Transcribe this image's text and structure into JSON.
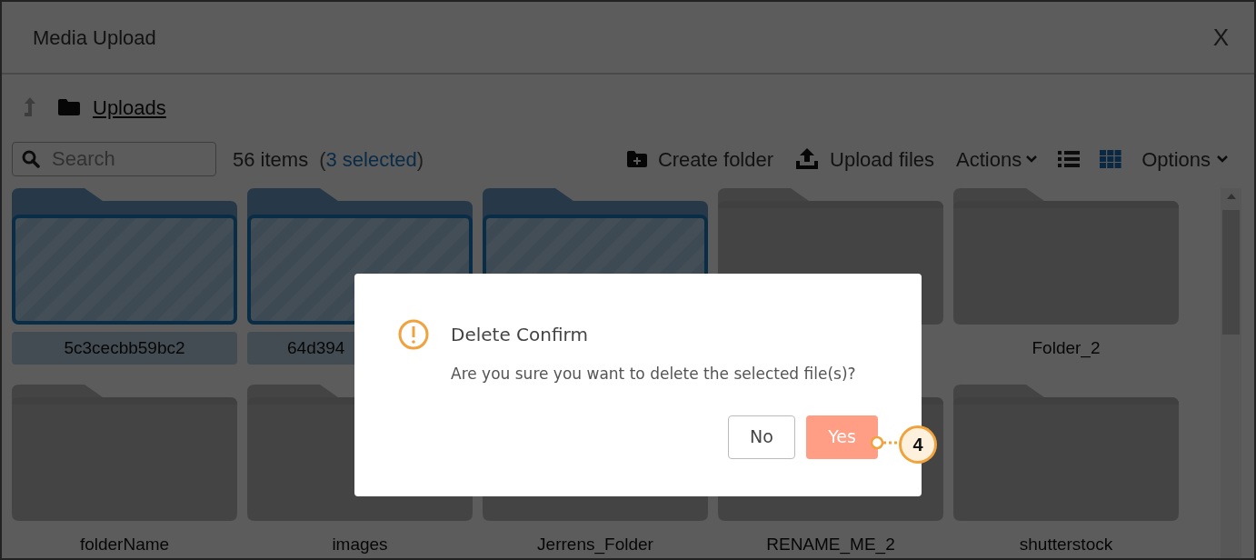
{
  "window": {
    "title": "Media Upload",
    "close": "X"
  },
  "breadcrumb": {
    "folder": "Uploads"
  },
  "toolbar": {
    "search": {
      "placeholder": "Search"
    },
    "count": "56 items",
    "open_paren": "(",
    "selected_count": "3 selected",
    "close_paren": ")",
    "buttons": [
      {
        "kind": "create",
        "label": "Create folder"
      },
      {
        "kind": "upload",
        "label": "Upload files"
      },
      {
        "kind": "menu",
        "label": "Actions"
      }
    ],
    "views": [
      {
        "kind": "list",
        "selected": false
      },
      {
        "kind": "grid",
        "selected": true
      }
    ],
    "options": "Options"
  },
  "folders": [
    {
      "name": "5c3cecbb59bc2",
      "selected": true
    },
    {
      "name": "64d394",
      "selected": true,
      "cut_off": true
    },
    {
      "selected": true
    },
    {
      "selected": false
    },
    {
      "name": "Folder_2",
      "selected": false
    },
    {
      "name": "folderName",
      "selected": false
    },
    {
      "name": "images",
      "selected": false
    },
    {
      "name": "Jerrens_Folder",
      "selected": false
    },
    {
      "name": "RENAME_ME_2",
      "selected": false
    },
    {
      "name": "shutterstock",
      "selected": false
    }
  ],
  "dialog": {
    "title": "Delete Confirm",
    "message": "Are you sure you want to delete the selected file(s)?",
    "buttons": [
      {
        "kind": "secondary",
        "label": "No"
      },
      {
        "kind": "primary",
        "label": "Yes"
      }
    ]
  },
  "callout": {
    "number": "4"
  }
}
